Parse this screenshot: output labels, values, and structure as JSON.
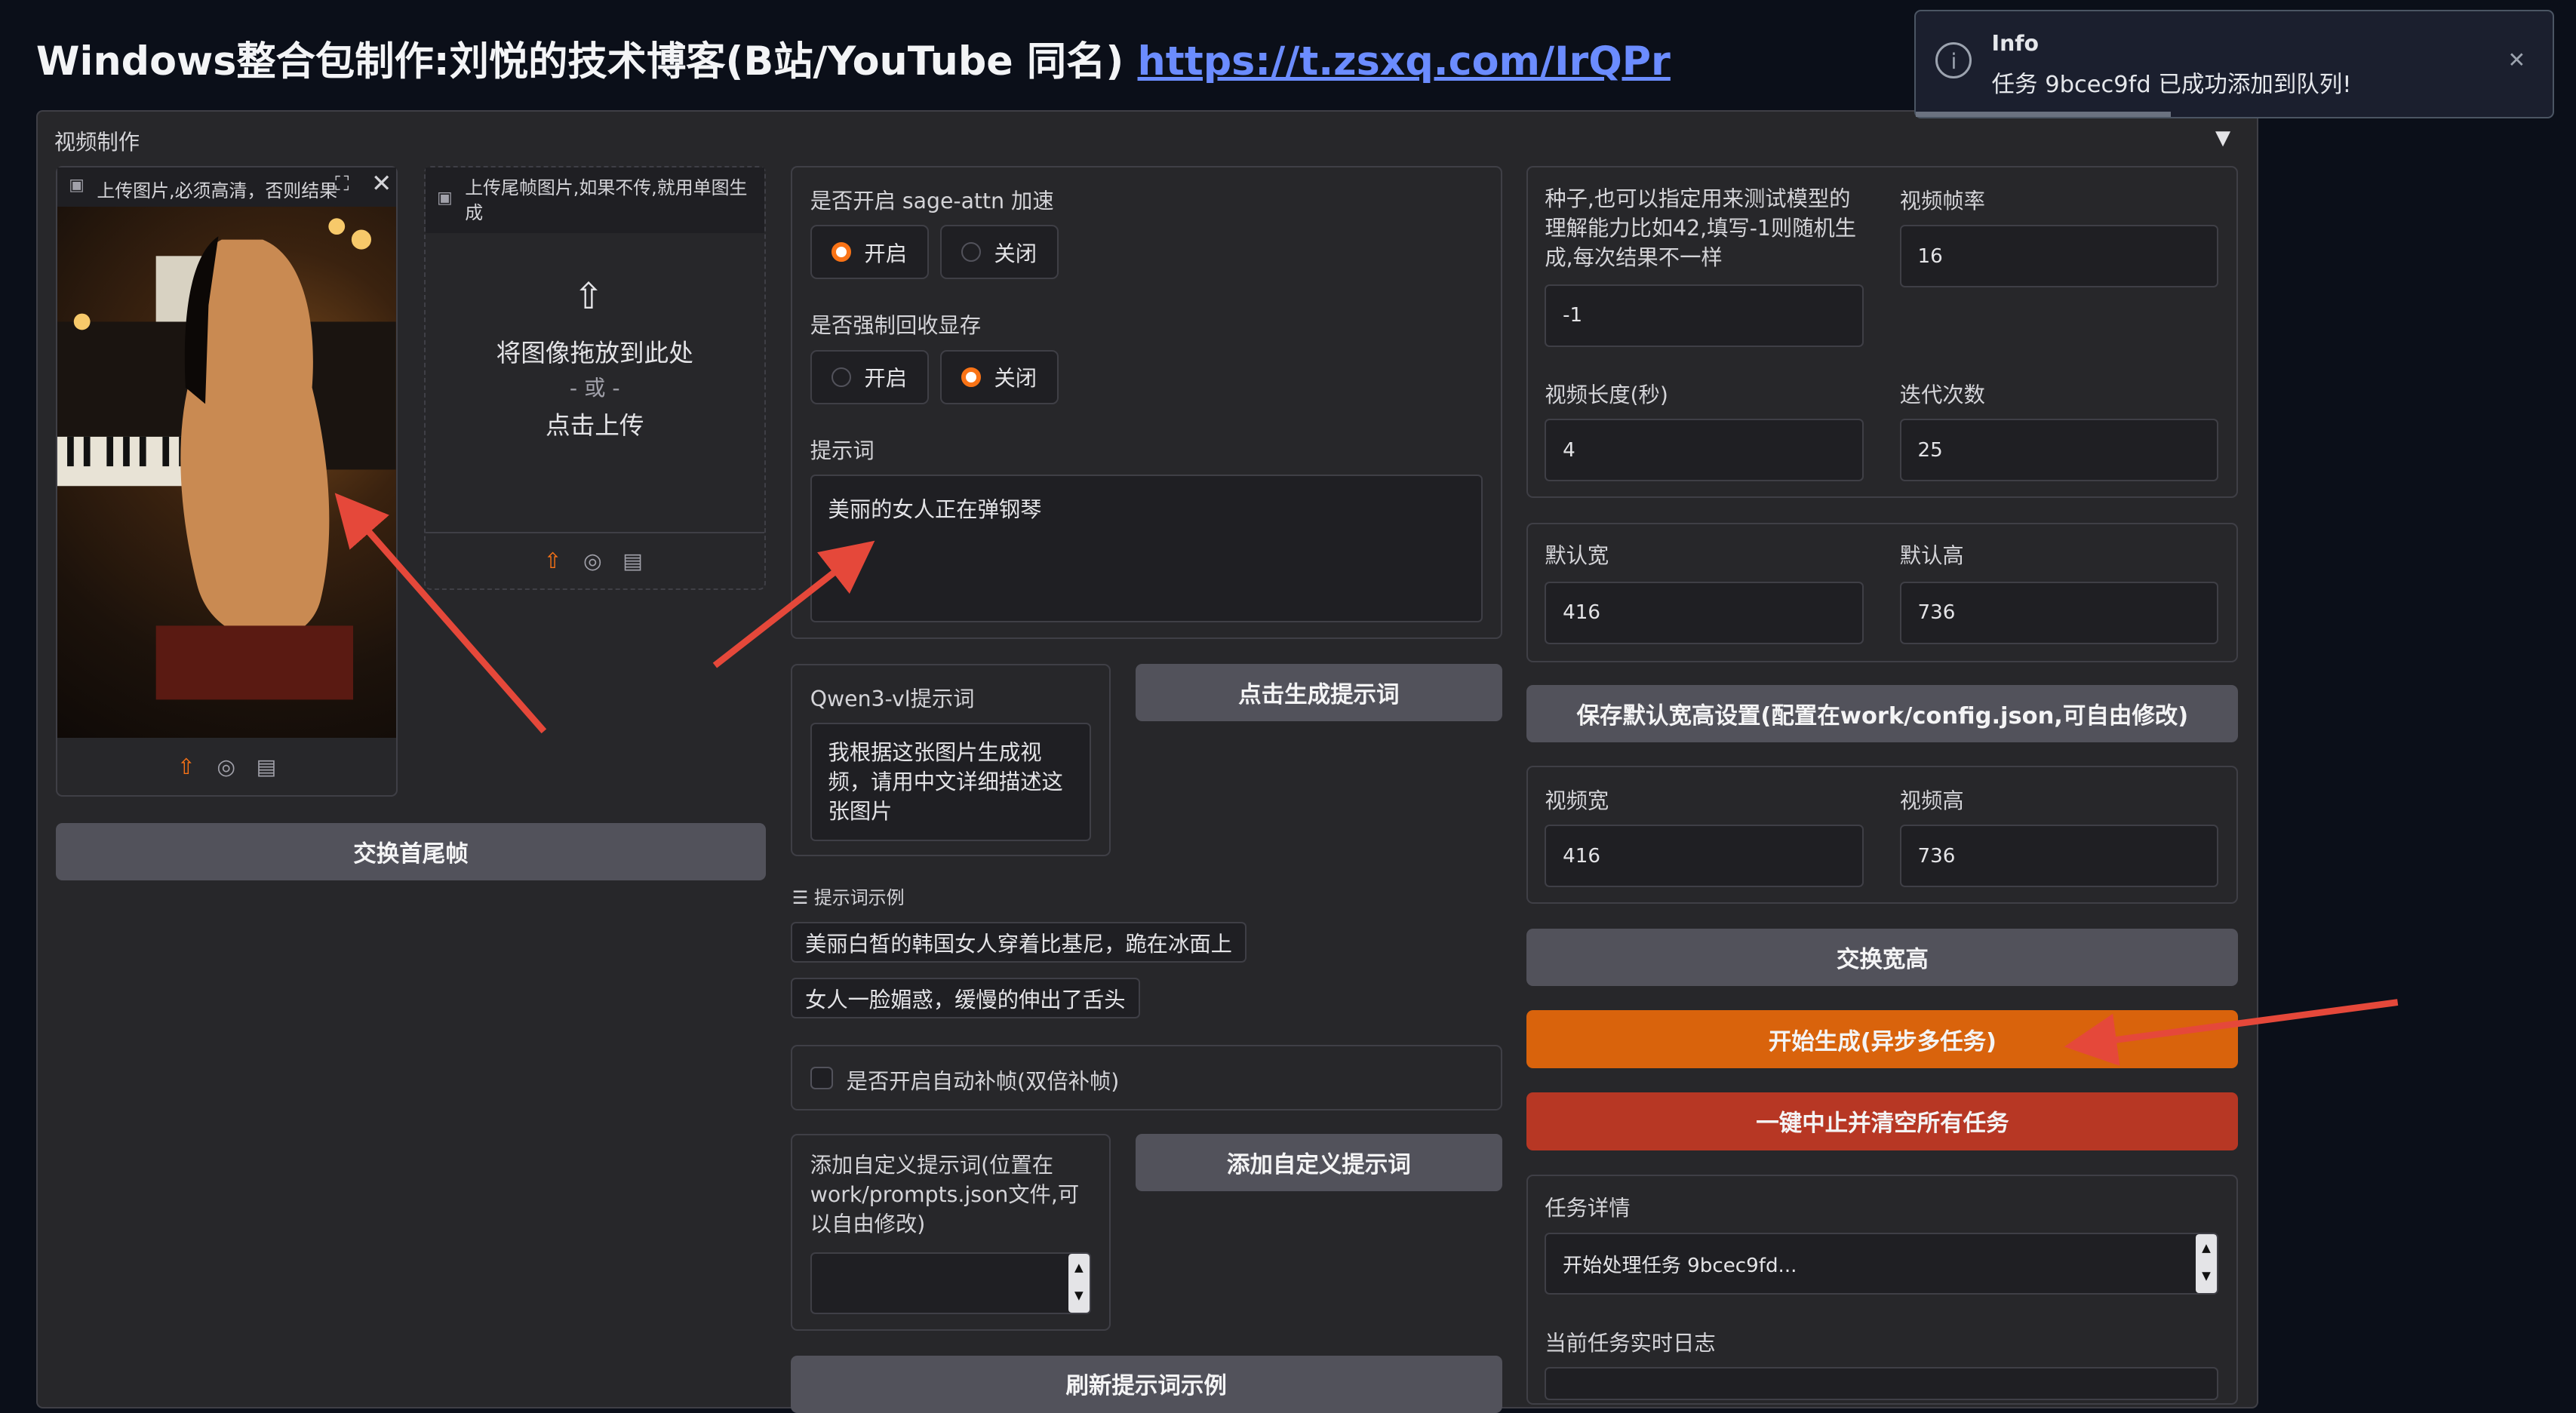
{
  "header": {
    "title": "Windows整合包制作:刘悦的技术博客(B站/YouTube 同名)",
    "link": "https://t.zsxq.com/IrQPr"
  },
  "panel": {
    "label": "视频制作"
  },
  "upload_first": {
    "label": "上传图片,必须高清，否则结果",
    "icons": [
      "upload-icon",
      "webcam-icon",
      "clipboard-icon"
    ]
  },
  "upload_last": {
    "label": "上传尾帧图片,如果不传,就用单图生成",
    "drop_text": "将图像拖放到此处",
    "or_text": "- 或 -",
    "click_text": "点击上传"
  },
  "swap_frames_button": "交换首尾帧",
  "sage_attn": {
    "label": "是否开启 sage-attn 加速",
    "options": [
      "开启",
      "关闭"
    ],
    "selected": "开启"
  },
  "force_gc": {
    "label": "是否强制回收显存",
    "options": [
      "开启",
      "关闭"
    ],
    "selected": "关闭"
  },
  "prompt": {
    "label": "提示词",
    "value": "美丽的女人正在弹钢琴"
  },
  "qwen": {
    "label": "Qwen3-vl提示词",
    "value": "我根据这张图片生成视频，请用中文详细描述这张图片"
  },
  "gen_prompt_button": "点击生成提示词",
  "examples": {
    "label": "提示词示例",
    "items": [
      "美丽白皙的韩国女人穿着比基尼，跪在冰面上",
      "女人一脸媚惑，缓慢的伸出了舌头"
    ]
  },
  "interp": {
    "label": "是否开启自动补帧(双倍补帧)",
    "checked": false
  },
  "custom_prompt": {
    "label": "添加自定义提示词(位置在work/prompts.json文件,可以自由修改)",
    "value": ""
  },
  "add_custom_button": "添加自定义提示词",
  "refresh_button": "刷新提示词示例",
  "seed": {
    "label": "种子,也可以指定用来测试模型的理解能力比如42,填写-1则随机生成,每次结果不一样",
    "value": "-1"
  },
  "fps": {
    "label": "视频帧率",
    "value": "16"
  },
  "duration": {
    "label": "视频长度(秒)",
    "value": "4"
  },
  "steps": {
    "label": "迭代次数",
    "value": "25"
  },
  "default_w": {
    "label": "默认宽",
    "value": "416"
  },
  "default_h": {
    "label": "默认高",
    "value": "736"
  },
  "save_defaults_button": "保存默认宽高设置(配置在work/config.json,可自由修改)",
  "video_w": {
    "label": "视频宽",
    "value": "416"
  },
  "video_h": {
    "label": "视频高",
    "value": "736"
  },
  "swap_wh_button": "交换宽高",
  "start_button": "开始生成(异步多任务)",
  "stop_button": "一键中止并清空所有任务",
  "task_detail": {
    "label": "任务详情",
    "value": "开始处理任务 9bcec9fd..."
  },
  "log": {
    "label": "当前任务实时日志"
  },
  "toast": {
    "title": "Info",
    "message": "任务 9bcec9fd 已成功添加到队列!",
    "progress": 0.4
  },
  "colors": {
    "accent_orange": "#d9630c",
    "danger_red": "#b73724",
    "annotation_arrow": "#e5483a"
  }
}
